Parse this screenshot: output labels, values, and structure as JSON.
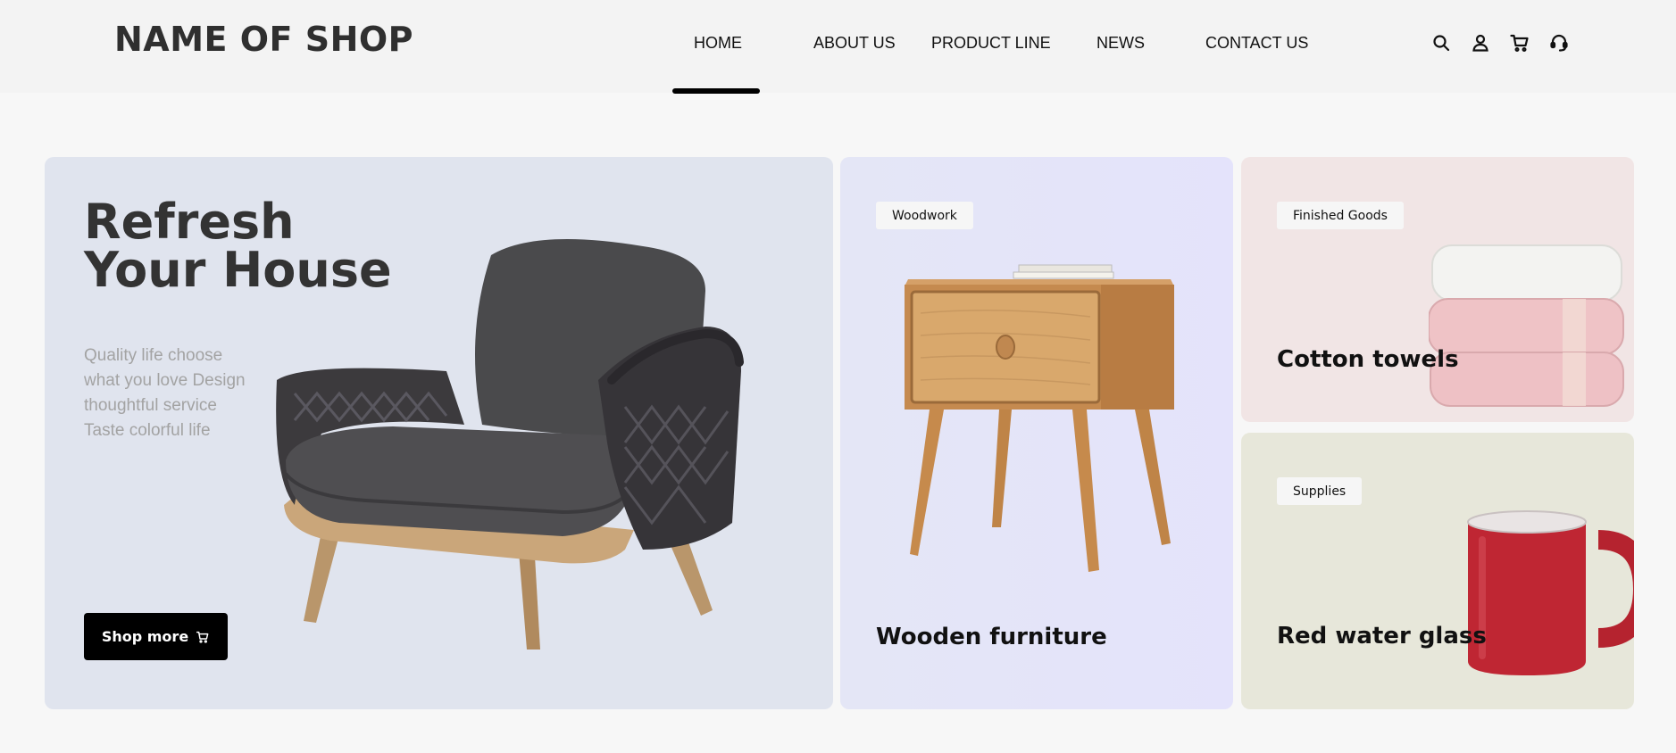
{
  "header": {
    "logo": "NAME OF SHOP",
    "nav": [
      {
        "label": "HOME",
        "active": true
      },
      {
        "label": "ABOUT US",
        "active": false
      },
      {
        "label": "PRODUCT LINE",
        "active": false
      },
      {
        "label": "NEWS",
        "active": false
      },
      {
        "label": "CONTACT US",
        "active": false
      }
    ],
    "icons": [
      "search-icon",
      "user-icon",
      "cart-icon",
      "headset-icon"
    ]
  },
  "hero": {
    "title_line1": "Refresh",
    "title_line2": "Your House",
    "desc": [
      "Quality life choose",
      "what you love Design",
      "thoughtful service",
      "Taste colorful life"
    ],
    "button_label": "Shop more",
    "button_icon": "cart-icon"
  },
  "cards": {
    "wood": {
      "tag": "Woodwork",
      "title": "Wooden  furniture"
    },
    "towel": {
      "tag": "Finished Goods",
      "title": "Cotton towels"
    },
    "mug": {
      "tag": "Supplies",
      "title": "Red water glass"
    }
  },
  "colors": {
    "hero_bg": "#e0e4ee",
    "wood_bg": "#e4e4f8",
    "towel_bg": "#f1e5e5",
    "mug_bg": "#e7e7da",
    "accent": "#000000"
  }
}
